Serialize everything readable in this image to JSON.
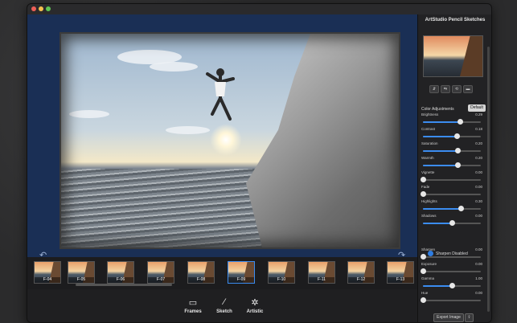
{
  "panel": {
    "title": "ArtStudio Pencil Sketches",
    "color_adjustments": "Color Adjustments",
    "default_button": "Default",
    "preview_buttons": [
      "⇵",
      "⇆",
      "⟲",
      "▬"
    ],
    "adjustments": [
      {
        "label": "Brightness",
        "value": "0.29",
        "pos": 0.64
      },
      {
        "label": "Contrast",
        "value": "0.18",
        "pos": 0.59
      },
      {
        "label": "Saturation",
        "value": "0.20",
        "pos": 0.6
      },
      {
        "label": "Warmth",
        "value": "0.20",
        "pos": 0.6
      },
      {
        "label": "Vignette",
        "value": "0.00",
        "pos": 0.0
      },
      {
        "label": "Fade",
        "value": "0.00",
        "pos": 0.0
      },
      {
        "label": "Highlights",
        "value": "0.30",
        "pos": 0.65
      },
      {
        "label": "Shadows",
        "value": "0.00",
        "pos": 0.5
      },
      {
        "label": "Sharpen",
        "value": "0.00",
        "pos": 0.0
      },
      {
        "label": "Exposure",
        "value": "0.00",
        "pos": 0.0
      },
      {
        "label": "Gamma",
        "value": "1.00",
        "pos": 0.5
      },
      {
        "label": "Hue",
        "value": "0.00",
        "pos": 0.0
      }
    ],
    "sharpen_toggle": "Sharpen Disabled",
    "export_button": "Export Image",
    "share_icon": "⇪"
  },
  "thumbnails": [
    "F-04",
    "F-05",
    "F-06",
    "F-07",
    "F-08",
    "F-09",
    "F-10",
    "F-11",
    "F-12",
    "F-13"
  ],
  "tools": [
    {
      "name": "frames",
      "label": "Frames",
      "icon": "▭"
    },
    {
      "name": "sketch",
      "label": "Sketch",
      "icon": "⁄"
    },
    {
      "name": "artistic",
      "label": "Artistic",
      "icon": "✲"
    }
  ],
  "canvas": {
    "undo": "↶",
    "redo": "↷"
  },
  "colors": {
    "accent": "#3b8cf0",
    "canvas_bg": "#1a2f55"
  }
}
